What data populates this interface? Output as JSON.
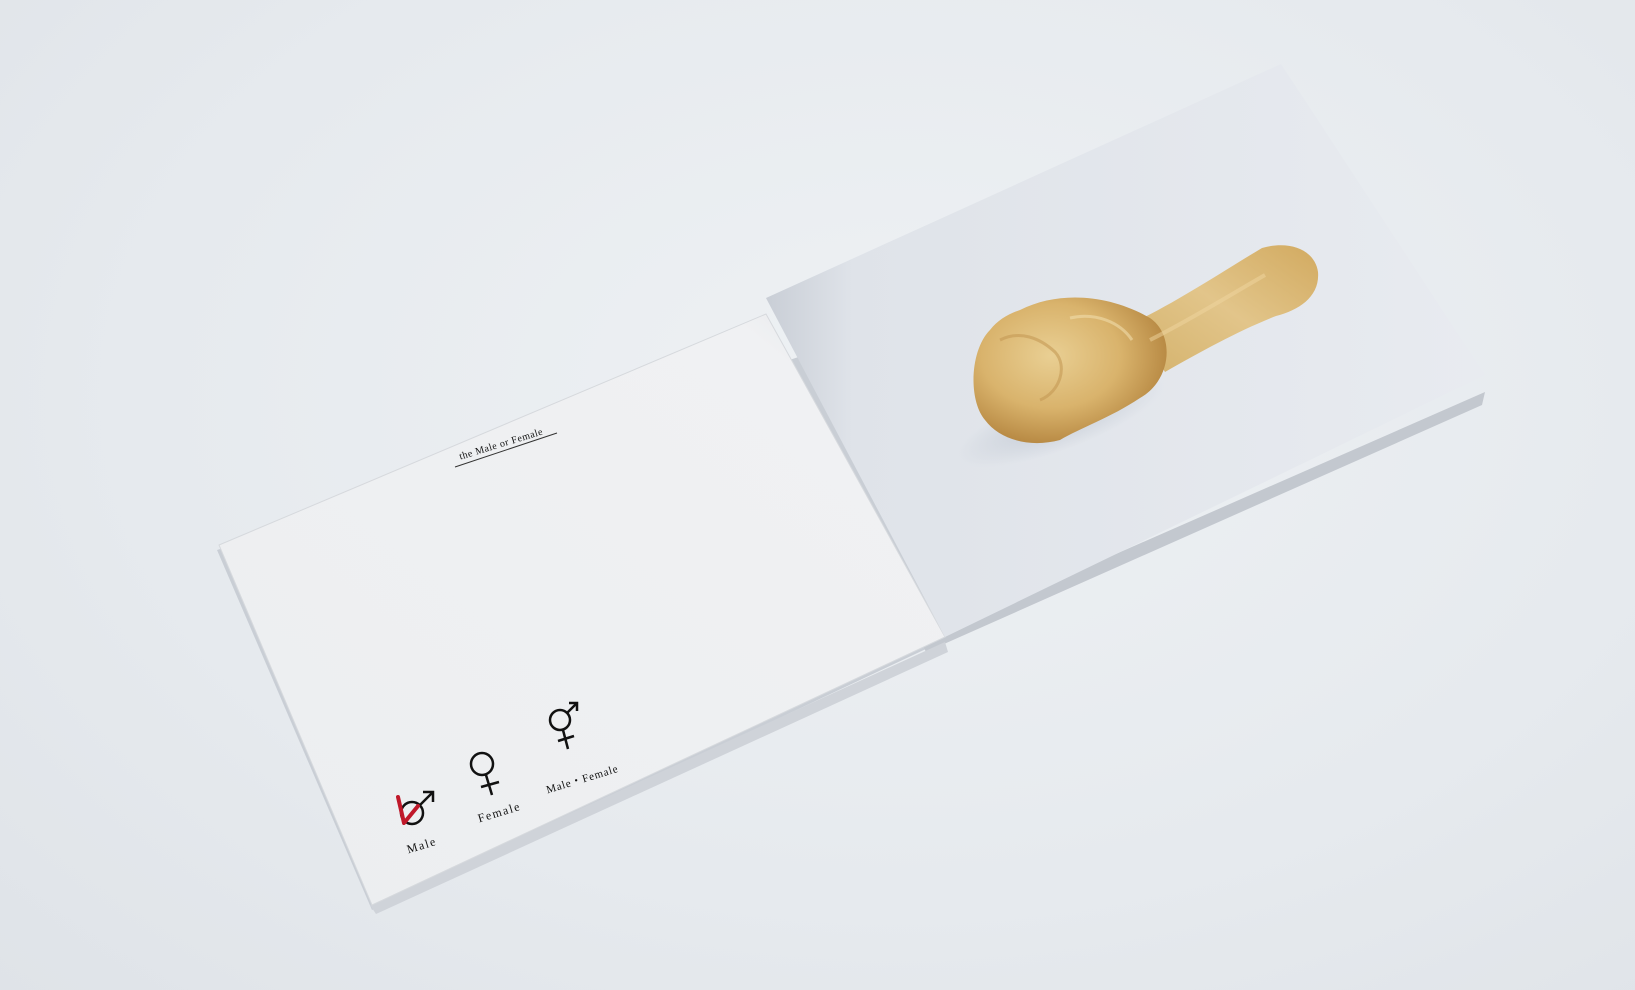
{
  "page_text": {
    "title": "the Male or Female",
    "options": [
      {
        "label": "Male",
        "icon": "male-symbol-icon",
        "checked": true
      },
      {
        "label": "Female",
        "icon": "female-symbol-icon",
        "checked": false
      },
      {
        "label": "Male・Female",
        "icon": "male-female-symbol-icon",
        "checked": false
      }
    ]
  },
  "colors": {
    "background": "#e6eaee",
    "page": "#eef0f2",
    "photo_page": "#e4e8ee",
    "check_mark": "#c0182a",
    "ink": "#111111"
  },
  "icons": {
    "check": "check-mark-icon",
    "chicken": "fried-chicken-drumstick-image"
  }
}
